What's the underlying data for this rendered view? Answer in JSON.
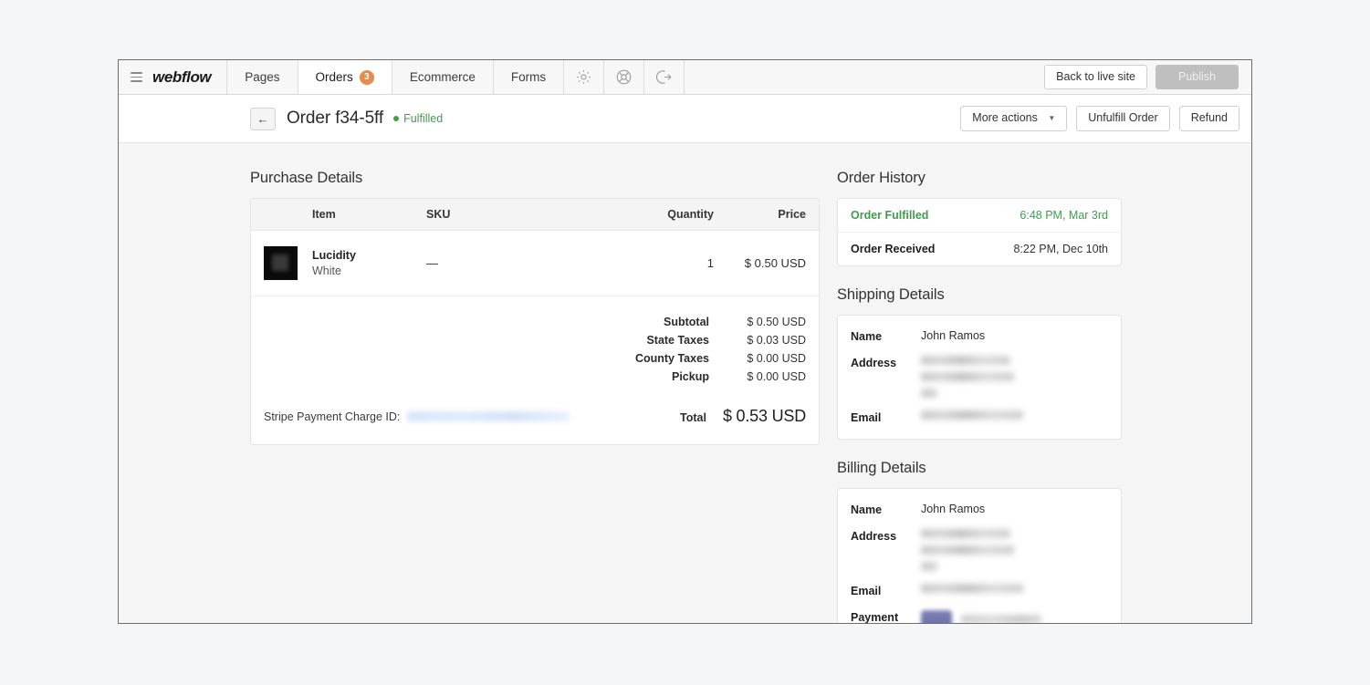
{
  "nav": {
    "brand": "webflow",
    "menu_icon": "hamburger-icon",
    "tabs": [
      {
        "label": "Pages",
        "badge": null,
        "active": false
      },
      {
        "label": "Orders",
        "badge": "3",
        "active": true
      },
      {
        "label": "Ecommerce",
        "badge": null,
        "active": false
      },
      {
        "label": "Forms",
        "badge": null,
        "active": false
      }
    ],
    "icons": [
      {
        "name": "gear-icon"
      },
      {
        "name": "lifebuoy-icon"
      },
      {
        "name": "logout-icon"
      }
    ],
    "back_to_live_site": "Back to live site",
    "publish": "Publish"
  },
  "order_header": {
    "back_icon": "arrow-left-icon",
    "title": "Order f34-5ff",
    "status": "Fulfilled",
    "status_color": "#3f9c4f",
    "more_actions": "More actions",
    "unfulfill_order": "Unfulfill Order",
    "refund": "Refund"
  },
  "purchase": {
    "title": "Purchase Details",
    "columns": [
      "Item",
      "SKU",
      "Quantity",
      "Price"
    ],
    "rows": [
      {
        "item_name": "Lucidity",
        "item_variant": "White",
        "sku": "—",
        "quantity": "1",
        "price": "$ 0.50 USD"
      }
    ],
    "totals": [
      {
        "label": "Subtotal",
        "value": "$ 0.50 USD"
      },
      {
        "label": "State Taxes",
        "value": "$ 0.03 USD"
      },
      {
        "label": "County Taxes",
        "value": "$ 0.00 USD"
      },
      {
        "label": "Pickup",
        "value": "$ 0.00 USD"
      }
    ],
    "charge_label": "Stripe Payment Charge ID:",
    "charge_id": "",
    "total_label": "Total",
    "total_value": "$ 0.53 USD"
  },
  "order_history": {
    "title": "Order History",
    "entries": [
      {
        "event": "Order Fulfilled",
        "time": "6:48 PM, Mar 3rd"
      },
      {
        "event": "Order Received",
        "time": "8:22 PM, Dec 10th"
      }
    ]
  },
  "shipping": {
    "title": "Shipping Details",
    "name_label": "Name",
    "name_value": "John Ramos",
    "address_label": "Address",
    "email_label": "Email"
  },
  "billing": {
    "title": "Billing Details",
    "name_label": "Name",
    "name_value": "John Ramos",
    "address_label": "Address",
    "email_label": "Email",
    "payment_label": "Payment"
  }
}
